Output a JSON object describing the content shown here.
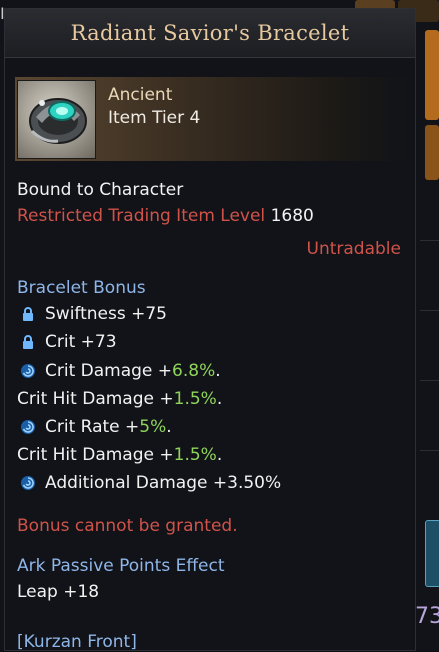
{
  "tooltip": {
    "title": "Radiant Savior's Bracelet",
    "grade": "Ancient",
    "tier": "Item Tier 4",
    "bound": "Bound to Character",
    "restricted_label": "Restricted Trading Item Level",
    "item_level": "1680",
    "tradable": "Untradable",
    "bonus_header": "Bracelet Bonus",
    "stats": [
      {
        "icon": "lock-icon",
        "label": "Swiftness",
        "value": "+75",
        "suffix": ""
      },
      {
        "icon": "lock-icon",
        "label": "Crit",
        "value": "+73",
        "suffix": ""
      },
      {
        "icon": "swirl-icon",
        "label": "Crit Damage",
        "value": "+",
        "green": "6.8%",
        "suffix": "."
      },
      {
        "icon": "",
        "label": "Crit Hit Damage",
        "value": "+",
        "green": "1.5%",
        "suffix": "."
      },
      {
        "icon": "swirl-icon",
        "label": "Crit Rate",
        "value": "+",
        "green": "5%",
        "suffix": "."
      },
      {
        "icon": "",
        "label": "Crit Hit Damage",
        "value": "+",
        "green": "1.5%",
        "suffix": "."
      },
      {
        "icon": "swirl-icon",
        "label": "Additional Damage",
        "value": "+3.50%",
        "suffix": ""
      }
    ],
    "bonus_note": "Bonus cannot be granted.",
    "ark_header": "Ark Passive Points Effect",
    "ark_value": "Leap +18",
    "region": "[Kurzan Front]"
  },
  "background": {
    "fragments": [
      "I",
      "73"
    ]
  }
}
